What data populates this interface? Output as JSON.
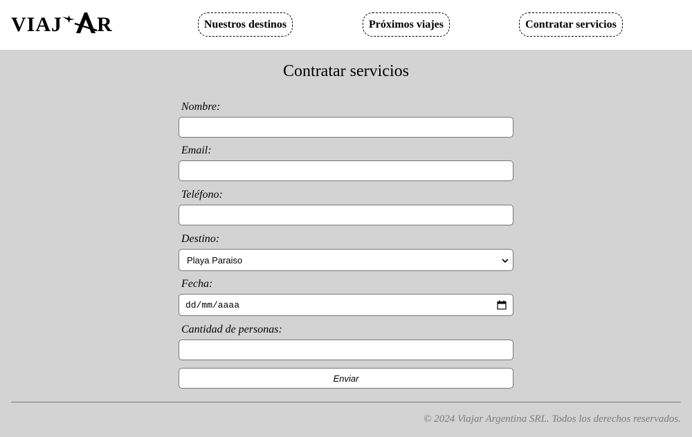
{
  "brand": {
    "logo_left": "VIAJ",
    "logo_right": "R",
    "logo_mark": "plane-and-A-mark"
  },
  "nav": {
    "items": [
      {
        "label": "Nuestros destinos"
      },
      {
        "label": "Próximos viajes"
      },
      {
        "label": "Contratar servicios"
      }
    ]
  },
  "main": {
    "title": "Contratar servicios"
  },
  "form": {
    "nombre_label": "Nombre:",
    "nombre_value": "",
    "email_label": "Email:",
    "email_value": "",
    "telefono_label": "Teléfono:",
    "telefono_value": "",
    "destino_label": "Destino:",
    "destino_selected": "Playa Paraiso",
    "fecha_label": "Fecha:",
    "fecha_placeholder": "dd/mm/aaaa",
    "personas_label": "Cantidad de personas:",
    "personas_value": "",
    "submit_label": "Enviar"
  },
  "footer": {
    "text": "© 2024 Viajar Argentina SRL. Todos los derechos reservados."
  },
  "colors": {
    "page_bg": "#d3d3d3",
    "header_bg": "#ffffff",
    "footer_text": "#7a7a7a"
  }
}
